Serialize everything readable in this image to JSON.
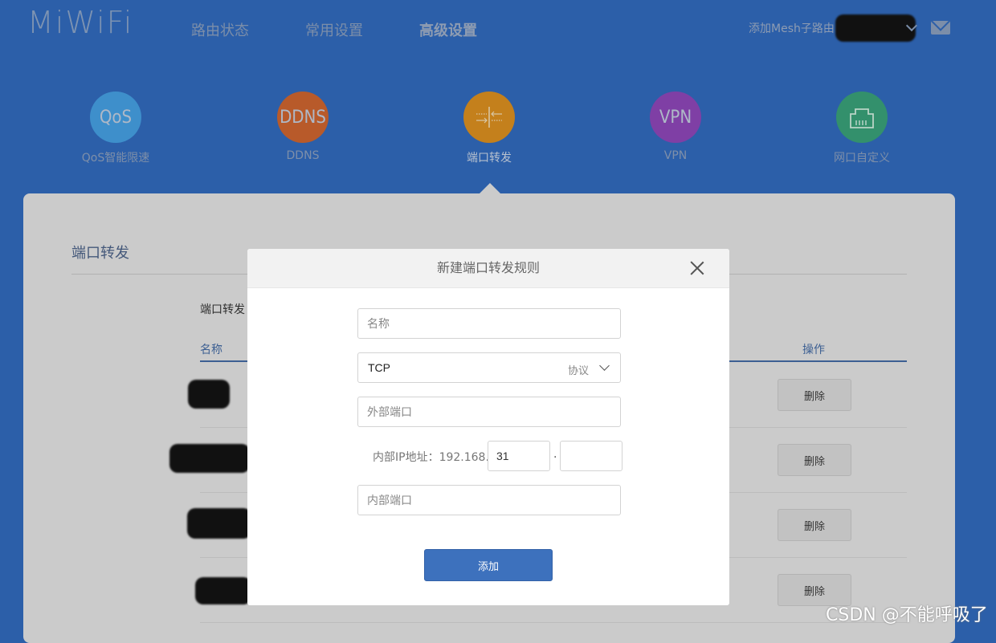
{
  "header": {
    "logo": "MiWiFi",
    "nav": [
      "路由状态",
      "常用设置",
      "高级设置"
    ],
    "mesh_label": "添加Mesh子路由"
  },
  "features": [
    {
      "icon_text": "QoS",
      "label": "QoS智能限速",
      "color": "#3e8fcb",
      "icon": "qos-icon"
    },
    {
      "icon_text": "DDNS",
      "label": "DDNS",
      "color": "#b85a2a",
      "icon": "ddns-icon"
    },
    {
      "icon_text": "",
      "label": "端口转发",
      "color": "#c4801c",
      "icon": "port-forward-icon"
    },
    {
      "icon_text": "VPN",
      "label": "VPN",
      "color": "#7f3fa5",
      "icon": "vpn-icon"
    },
    {
      "icon_text": "",
      "label": "网口自定义",
      "color": "#33906c",
      "icon": "ethernet-icon"
    }
  ],
  "panel": {
    "title": "端口转发",
    "section_label": "端口转发",
    "col_name": "名称",
    "col_action": "操作",
    "delete_label": "删除"
  },
  "modal": {
    "title": "新建端口转发规则",
    "name_placeholder": "名称",
    "protocol_value": "TCP",
    "protocol_hint": "协议",
    "external_port_placeholder": "外部端口",
    "ip_label": "内部IP地址：192.168.",
    "ip_third": "31",
    "ip_fourth": "",
    "ip_dot": ".",
    "internal_port_placeholder": "内部端口",
    "add_label": "添加"
  },
  "watermark": "CSDN @不能呼吸了"
}
